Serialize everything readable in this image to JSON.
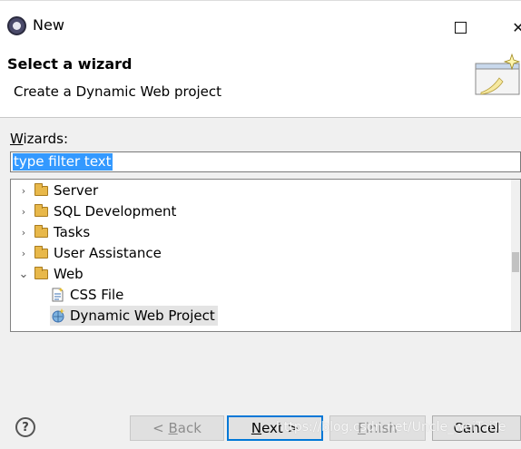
{
  "window": {
    "title": "New",
    "minimize_glyph": "—",
    "close_glyph": "✕",
    "app_icon": "eclipse-icon"
  },
  "header": {
    "title": "Select a wizard",
    "description": "Create a Dynamic Web project",
    "banner_icon": "new-wizard-icon"
  },
  "wizards_label": {
    "mnemonic": "W",
    "rest": "izards:"
  },
  "filter": {
    "value": "type filter text"
  },
  "tree": {
    "items": [
      {
        "label": "Server",
        "expanded": false,
        "icon": "folder-icon"
      },
      {
        "label": "SQL Development",
        "expanded": false,
        "icon": "folder-icon"
      },
      {
        "label": "Tasks",
        "expanded": false,
        "icon": "folder-icon"
      },
      {
        "label": "User Assistance",
        "expanded": false,
        "icon": "folder-icon"
      },
      {
        "label": "Web",
        "expanded": true,
        "icon": "folder-icon"
      }
    ],
    "children": [
      {
        "label": "CSS File",
        "icon": "css-file-icon"
      },
      {
        "label": "Dynamic Web Project",
        "icon": "web-project-icon",
        "selected": true
      }
    ],
    "twisty_collapsed": "›",
    "twisty_expanded": "⌄"
  },
  "buttons": {
    "help": "?",
    "back": {
      "pre": "< ",
      "mnemonic": "B",
      "rest": "ack"
    },
    "next": {
      "mnemonic": "N",
      "rest": "ext >"
    },
    "finish": {
      "mnemonic": "F",
      "rest": "inish"
    },
    "cancel": "Cancel"
  },
  "watermark": "https://blog.csdn.net/Uncle_weiTaiTe",
  "colors": {
    "selection": "#3399ff",
    "default_button_border": "#0078d7",
    "folder": "#e8b84a"
  }
}
